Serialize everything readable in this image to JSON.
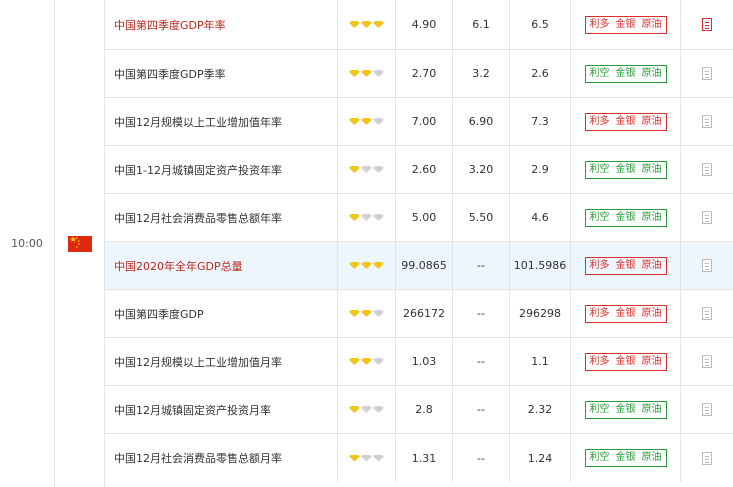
{
  "time": "10:00",
  "country_flag": "china-flag",
  "colors": {
    "red": "#b8271c",
    "bullish_red": "#d9302c",
    "bearish_green": "#2a9b3a",
    "gem_gold": "#f2c418",
    "gem_gray": "#cfcfcf",
    "highlight": "#eef6fd"
  },
  "rows": [
    {
      "name": "中国第四季度GDP年率",
      "stars": 3,
      "previous": "4.90",
      "forecast": "6.1",
      "actual": "6.5",
      "impact": [
        "利多",
        "金银",
        "原油"
      ],
      "impact_color": "red",
      "name_red": true,
      "doc_red": true
    },
    {
      "name": "中国第四季度GDP季率",
      "stars": 2,
      "previous": "2.70",
      "forecast": "3.2",
      "actual": "2.6",
      "impact": [
        "利空",
        "金银",
        "原油"
      ],
      "impact_color": "green",
      "name_red": false,
      "doc_red": false
    },
    {
      "name": "中国12月规模以上工业增加值年率",
      "stars": 2,
      "previous": "7.00",
      "forecast": "6.90",
      "actual": "7.3",
      "impact": [
        "利多",
        "金银",
        "原油"
      ],
      "impact_color": "red",
      "name_red": false,
      "doc_red": false
    },
    {
      "name": "中国1-12月城镇固定资产投资年率",
      "stars": 1,
      "previous": "2.60",
      "forecast": "3.20",
      "actual": "2.9",
      "impact": [
        "利空",
        "金银",
        "原油"
      ],
      "impact_color": "green",
      "name_red": false,
      "doc_red": false
    },
    {
      "name": "中国12月社会消费品零售总额年率",
      "stars": 1,
      "previous": "5.00",
      "forecast": "5.50",
      "actual": "4.6",
      "impact": [
        "利空",
        "金银",
        "原油"
      ],
      "impact_color": "green",
      "name_red": false,
      "doc_red": false
    },
    {
      "name": "中国2020年全年GDP总量",
      "stars": 3,
      "previous": "99.0865",
      "forecast": "--",
      "actual": "101.5986",
      "impact": [
        "利多",
        "金银",
        "原油"
      ],
      "impact_color": "red",
      "name_red": true,
      "doc_red": false
    },
    {
      "name": "中国第四季度GDP",
      "stars": 2,
      "previous": "266172",
      "forecast": "--",
      "actual": "296298",
      "impact": [
        "利多",
        "金银",
        "原油"
      ],
      "impact_color": "red",
      "name_red": false,
      "doc_red": false
    },
    {
      "name": "中国12月规模以上工业增加值月率",
      "stars": 2,
      "previous": "1.03",
      "forecast": "--",
      "actual": "1.1",
      "impact": [
        "利多",
        "金银",
        "原油"
      ],
      "impact_color": "red",
      "name_red": false,
      "doc_red": false
    },
    {
      "name": "中国12月城镇固定资产投资月率",
      "stars": 1,
      "previous": "2.8",
      "forecast": "--",
      "actual": "2.32",
      "impact": [
        "利空",
        "金银",
        "原油"
      ],
      "impact_color": "green",
      "name_red": false,
      "doc_red": false
    },
    {
      "name": "中国12月社会消费品零售总额月率",
      "stars": 1,
      "previous": "1.31",
      "forecast": "--",
      "actual": "1.24",
      "impact": [
        "利空",
        "金银",
        "原油"
      ],
      "impact_color": "green",
      "name_red": false,
      "doc_red": false
    }
  ]
}
